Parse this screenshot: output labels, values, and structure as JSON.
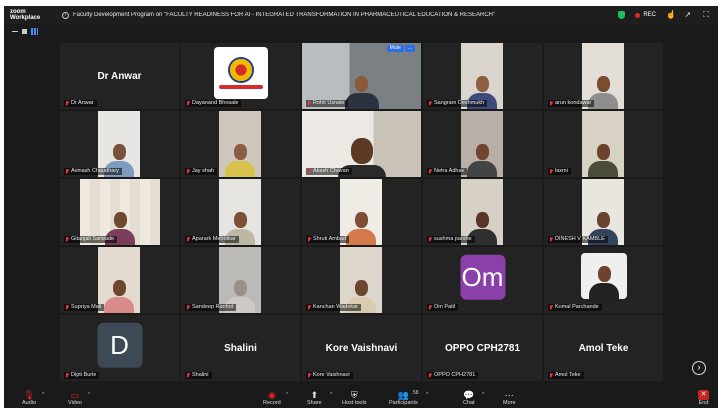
{
  "app": {
    "brand_line1": "zoom",
    "brand_line2": "Workplace"
  },
  "meeting": {
    "title": "Faculty Development Program on \"FACULTY READINESS FOR AI - INTEGRATED TRANSFORMATION IN PHARMACEUTICAL EDUCATION & RESEARCH\"",
    "rec_label": "REC"
  },
  "colors": {
    "accent_blue": "#2e6fe6",
    "active_speaker": "#23d26a",
    "muted_red": "#e23b3b",
    "om_avatar": "#8a3fa9",
    "d_avatar": "#3d4a55"
  },
  "tiles": [
    {
      "name": "Dr Anwar",
      "display": "Dr Anwar"
    },
    {
      "name": "Dayanand Bhosale"
    },
    {
      "name": "Rohit Usnale",
      "chip": [
        "Mute",
        "..."
      ]
    },
    {
      "name": "Sangram Deshmukh"
    },
    {
      "name": "arun kondawar"
    },
    {
      "name": "Avinash Chaudhary"
    },
    {
      "name": "Jay shah"
    },
    {
      "name": "Akash Chavan"
    },
    {
      "name": "Netra Adhav"
    },
    {
      "name": "laxmi"
    },
    {
      "name": "Gitanjali Sarwade"
    },
    {
      "name": "Aparark Mehotkar"
    },
    {
      "name": "Shruti Ambad"
    },
    {
      "name": "sushma parshe"
    },
    {
      "name": "DINESH V KAMBLE"
    },
    {
      "name": "Supriya Mali"
    },
    {
      "name": "Sandeep Ranhot"
    },
    {
      "name": "Kanchan Wadekar"
    },
    {
      "name": "Om Patil",
      "avatar": "Om"
    },
    {
      "name": "Komal Parchande"
    },
    {
      "name": "Dipti Burle",
      "avatar": "D"
    },
    {
      "name": "Shalini",
      "display": "Shalini"
    },
    {
      "name": "Kore Vaishnavi",
      "display": "Kore Vaishnavi"
    },
    {
      "name": "OPPO CPH2781",
      "display": "OPPO CPH2781"
    },
    {
      "name": "Amol Teke",
      "display": "Amol Teke"
    }
  ],
  "toolbar": {
    "audio": "Audio",
    "video": "Video",
    "record": "Record",
    "share": "Share",
    "host_tools": "Host tools",
    "participants": "Participants",
    "participants_count": "58",
    "chat": "Chat",
    "more": "More",
    "end": "End"
  },
  "icons": [
    "info-icon",
    "shield-icon",
    "record-dot-icon",
    "reaction-icon",
    "share-icon",
    "fullscreen-icon",
    "gallery-view-icon",
    "mic-muted-icon",
    "video-off-icon",
    "record-icon",
    "share-screen-icon",
    "host-tools-icon",
    "participants-icon",
    "chat-icon",
    "more-icon",
    "end-icon",
    "next-page-icon"
  ]
}
